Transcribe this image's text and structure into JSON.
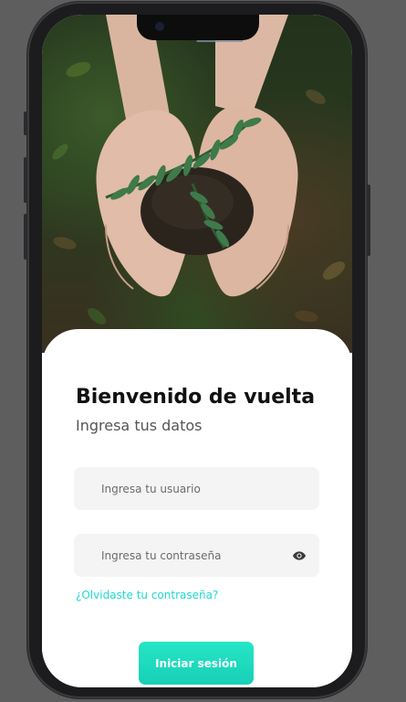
{
  "login": {
    "title": "Bienvenido de vuelta",
    "subtitle": "Ingresa tus datos",
    "username_placeholder": "Ingresa tu usuario",
    "password_placeholder": "Ingresa tu contraseña",
    "forgot_link": "¿Olvidaste tu contraseña?",
    "submit_label": "Iniciar sesión"
  },
  "icons": {
    "password_toggle": "eye-icon"
  },
  "colors": {
    "accent": "#1fd8cf",
    "button": "#1ed8bf",
    "field_bg": "#f4f4f4"
  }
}
